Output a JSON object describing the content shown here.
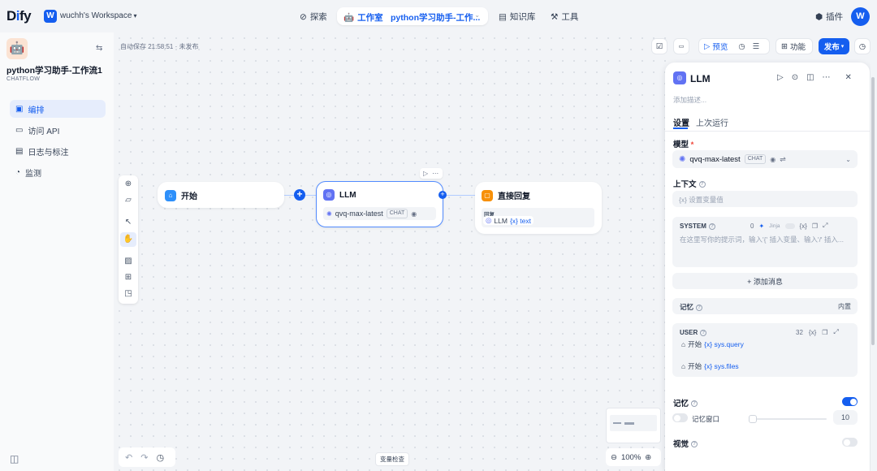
{
  "topbar": {
    "logo": "Dify",
    "workspace_initial": "W",
    "workspace_name": "wuchh's Workspace",
    "nav_explore": "探索",
    "nav_studio": "工作室",
    "nav_app_name": "python学习助手-工作...",
    "nav_knowledge": "知识库",
    "nav_tools": "工具",
    "plugins": "插件",
    "avatar_initial": "W"
  },
  "sidebar": {
    "app_title": "python学习助手-工作流1",
    "app_type": "CHATFLOW",
    "items": [
      {
        "label": "编排",
        "icon": "layout-icon",
        "active": true
      },
      {
        "label": "访问 API",
        "icon": "terminal-icon",
        "active": false
      },
      {
        "label": "日志与标注",
        "icon": "document-icon",
        "active": false
      },
      {
        "label": "监测",
        "icon": "monitor-icon",
        "active": false
      }
    ]
  },
  "canvas": {
    "autosave": "自动保存 21:58:51 · 未发布",
    "nodes": {
      "start": {
        "title": "开始"
      },
      "llm": {
        "title": "LLM",
        "model": "qvq-max-latest",
        "model_tag": "CHAT"
      },
      "answer": {
        "title": "直接回复",
        "field_label": "回复",
        "var_source": "LLM",
        "var_name": "{x} text"
      }
    },
    "var_inspect": "变量检查",
    "zoom": "100%"
  },
  "header_actions": {
    "preview": "预览",
    "features": "功能",
    "publish": "发布"
  },
  "panel": {
    "title": "LLM",
    "desc_placeholder": "添加描述...",
    "tab_settings": "设置",
    "tab_last_run": "上次运行",
    "model_label": "模型",
    "model_required": "*",
    "model_name": "qvq-max-latest",
    "model_tag": "CHAT",
    "context_label": "上下文",
    "context_placeholder": "{x}  设置变量值",
    "system_label": "SYSTEM",
    "system_count": "0",
    "system_jinja": "Jinja",
    "system_placeholder": "在这里写你的提示词，输入'{' 插入变量、输入'/' 插入...",
    "add_message": "+ 添加消息",
    "memory_row_label": "记忆",
    "memory_row_value": "内置",
    "user_label": "USER",
    "user_count": "32",
    "user_var1_source": "开始",
    "user_var1_name": "{x} sys.query",
    "user_var2_source": "开始",
    "user_var2_name": "{x} sys.files",
    "memory_label": "记忆",
    "memory_on": true,
    "memory_window_label": "记忆窗口",
    "memory_window_value": "10",
    "memory_window_level": 0.05,
    "vision_label": "视觉",
    "vision_on": false
  },
  "colors": {
    "accent": "#155eef",
    "start_icon": "#2e90fa",
    "llm_icon": "#6172f3",
    "answer_icon": "#f79009"
  }
}
